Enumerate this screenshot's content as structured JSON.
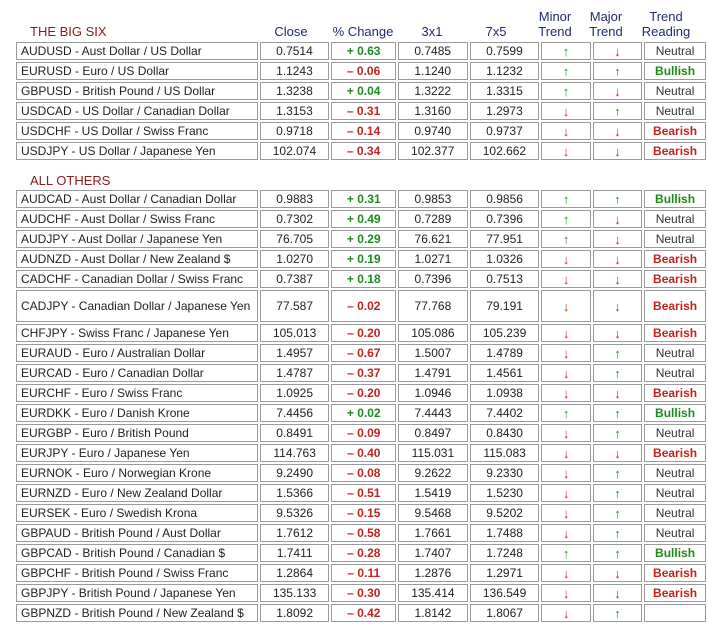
{
  "headers": {
    "title": "THE BIG SIX",
    "close": "Close",
    "change": "% Change",
    "c3x1": "3x1",
    "c7x5": "7x5",
    "minor": "Minor Trend",
    "major": "Major Trend",
    "reading": "Trend Reading"
  },
  "sections": {
    "all_others": "ALL OTHERS"
  },
  "colors": {
    "positive": "#1f8a1f",
    "negative": "#c0241c",
    "heading": "#1f2d6b",
    "section": "#8b1a1a"
  },
  "big_six": [
    {
      "pair": "AUDUSD - Aust Dollar / US Dollar",
      "close": "0.7514",
      "change": "+ 0.63",
      "dir": "pos",
      "c3": "0.7485",
      "c7": "0.7599",
      "minor": "up",
      "major": "down",
      "reading": "Neutral"
    },
    {
      "pair": "EURUSD - Euro / US Dollar",
      "close": "1.1243",
      "change": "– 0.06",
      "dir": "neg",
      "c3": "1.1240",
      "c7": "1.1232",
      "minor": "up",
      "major": "up",
      "reading": "Bullish"
    },
    {
      "pair": "GBPUSD - British Pound / US Dollar",
      "close": "1.3238",
      "change": "+ 0.04",
      "dir": "pos",
      "c3": "1.3222",
      "c7": "1.3315",
      "minor": "up",
      "major": "down",
      "reading": "Neutral"
    },
    {
      "pair": "USDCAD - US Dollar / Canadian Dollar",
      "close": "1.3153",
      "change": "– 0.31",
      "dir": "neg",
      "c3": "1.3160",
      "c7": "1.2973",
      "minor": "down",
      "major": "up",
      "reading": "Neutral"
    },
    {
      "pair": "USDCHF - US Dollar / Swiss Franc",
      "close": "0.9718",
      "change": "– 0.14",
      "dir": "neg",
      "c3": "0.9740",
      "c7": "0.9737",
      "minor": "down",
      "major": "down",
      "reading": "Bearish"
    },
    {
      "pair": "USDJPY - US Dollar / Japanese Yen",
      "close": "102.074",
      "change": "– 0.34",
      "dir": "neg",
      "c3": "102.377",
      "c7": "102.662",
      "minor": "down",
      "major": "down",
      "reading": "Bearish"
    }
  ],
  "others": [
    {
      "pair": "AUDCAD - Aust Dollar / Canadian Dollar",
      "close": "0.9883",
      "change": "+ 0.31",
      "dir": "pos",
      "c3": "0.9853",
      "c7": "0.9856",
      "minor": "up",
      "major": "up",
      "reading": "Bullish"
    },
    {
      "pair": "AUDCHF - Aust Dollar / Swiss Franc",
      "close": "0.7302",
      "change": "+ 0.49",
      "dir": "pos",
      "c3": "0.7289",
      "c7": "0.7396",
      "minor": "up",
      "major": "down",
      "reading": "Neutral"
    },
    {
      "pair": "AUDJPY - Aust Dollar / Japanese Yen",
      "close": "76.705",
      "change": "+ 0.29",
      "dir": "pos",
      "c3": "76.621",
      "c7": "77.951",
      "minor": "up",
      "major": "down",
      "reading": "Neutral"
    },
    {
      "pair": "AUDNZD - Aust Dollar / New Zealand $",
      "close": "1.0270",
      "change": "+ 0.19",
      "dir": "pos",
      "c3": "1.0271",
      "c7": "1.0326",
      "minor": "down",
      "major": "down",
      "reading": "Bearish"
    },
    {
      "pair": "CADCHF - Canadian Dollar / Swiss Franc",
      "close": "0.7387",
      "change": "+ 0.18",
      "dir": "pos",
      "c3": "0.7396",
      "c7": "0.7513",
      "minor": "down",
      "major": "down",
      "reading": "Bearish"
    },
    {
      "pair": "CADJPY - Canadian Dollar / Japanese Yen",
      "close": "77.587",
      "change": "– 0.02",
      "dir": "neg",
      "c3": "77.768",
      "c7": "79.191",
      "minor": "down",
      "major": "down",
      "reading": "Bearish",
      "wrap": true
    },
    {
      "pair": "CHFJPY - Swiss Franc / Japanese Yen",
      "close": "105.013",
      "change": "– 0.20",
      "dir": "neg",
      "c3": "105.086",
      "c7": "105.239",
      "minor": "down",
      "major": "down",
      "reading": "Bearish"
    },
    {
      "pair": "EURAUD - Euro / Australian Dollar",
      "close": "1.4957",
      "change": "– 0.67",
      "dir": "neg",
      "c3": "1.5007",
      "c7": "1.4789",
      "minor": "down",
      "major": "up",
      "reading": "Neutral"
    },
    {
      "pair": "EURCAD - Euro / Canadian Dollar",
      "close": "1.4787",
      "change": "– 0.37",
      "dir": "neg",
      "c3": "1.4791",
      "c7": "1.4561",
      "minor": "down",
      "major": "up",
      "reading": "Neutral"
    },
    {
      "pair": "EURCHF - Euro / Swiss Franc",
      "close": "1.0925",
      "change": "– 0.20",
      "dir": "neg",
      "c3": "1.0946",
      "c7": "1.0938",
      "minor": "down",
      "major": "down",
      "reading": "Bearish"
    },
    {
      "pair": "EURDKK - Euro / Danish Krone",
      "close": "7.4456",
      "change": "+ 0.02",
      "dir": "pos",
      "c3": "7.4443",
      "c7": "7.4402",
      "minor": "up",
      "major": "up",
      "reading": "Bullish"
    },
    {
      "pair": "EURGBP - Euro / British Pound",
      "close": "0.8491",
      "change": "– 0.09",
      "dir": "neg",
      "c3": "0.8497",
      "c7": "0.8430",
      "minor": "down",
      "major": "up",
      "reading": "Neutral"
    },
    {
      "pair": "EURJPY - Euro / Japanese Yen",
      "close": "114.763",
      "change": "– 0.40",
      "dir": "neg",
      "c3": "115.031",
      "c7": "115.083",
      "minor": "down",
      "major": "down",
      "reading": "Bearish"
    },
    {
      "pair": "EURNOK - Euro / Norwegian Krone",
      "close": "9.2490",
      "change": "– 0.08",
      "dir": "neg",
      "c3": "9.2622",
      "c7": "9.2330",
      "minor": "down",
      "major": "up",
      "reading": "Neutral"
    },
    {
      "pair": "EURNZD - Euro / New Zealand Dollar",
      "close": "1.5366",
      "change": "– 0.51",
      "dir": "neg",
      "c3": "1.5419",
      "c7": "1.5230",
      "minor": "down",
      "major": "up",
      "reading": "Neutral"
    },
    {
      "pair": "EURSEK - Euro / Swedish Krona",
      "close": "9.5326",
      "change": "– 0.15",
      "dir": "neg",
      "c3": "9.5468",
      "c7": "9.5202",
      "minor": "down",
      "major": "up",
      "reading": "Neutral"
    },
    {
      "pair": "GBPAUD - British Pound / Aust Dollar",
      "close": "1.7612",
      "change": "– 0.58",
      "dir": "neg",
      "c3": "1.7661",
      "c7": "1.7488",
      "minor": "down",
      "major": "up",
      "reading": "Neutral"
    },
    {
      "pair": "GBPCAD - British Pound / Canadian $",
      "close": "1.7411",
      "change": "– 0.28",
      "dir": "neg",
      "c3": "1.7407",
      "c7": "1.7248",
      "minor": "up",
      "major": "up",
      "reading": "Bullish"
    },
    {
      "pair": "GBPCHF - British Pound / Swiss Franc",
      "close": "1.2864",
      "change": "– 0.11",
      "dir": "neg",
      "c3": "1.2876",
      "c7": "1.2971",
      "minor": "down",
      "major": "down",
      "reading": "Bearish"
    },
    {
      "pair": "GBPJPY - British Pound / Japanese Yen",
      "close": "135.133",
      "change": "– 0.30",
      "dir": "neg",
      "c3": "135.414",
      "c7": "136.549",
      "minor": "down",
      "major": "down",
      "reading": "Bearish"
    },
    {
      "pair": "GBPNZD - British Pound / New Zealand $",
      "close": "1.8092",
      "change": "– 0.42",
      "dir": "neg",
      "c3": "1.8142",
      "c7": "1.8067",
      "minor": "down",
      "major": "up",
      "reading": ""
    }
  ]
}
